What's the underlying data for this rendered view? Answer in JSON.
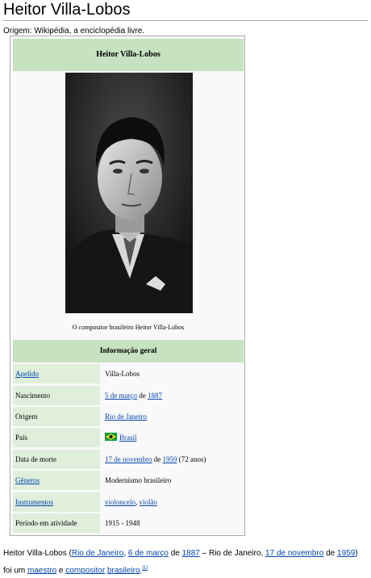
{
  "page": {
    "title": "Heitor Villa-Lobos",
    "subtitle": "Origem: Wikipédia, a enciclopédia livre."
  },
  "infobox": {
    "header": "Heitor Villa-Lobos",
    "caption": "O compositor brasileiro Heitor Villa-Lobos",
    "info_header": "Informação geral",
    "rows": [
      {
        "label": "Apelido",
        "label_link": true,
        "value": "Villa-Lobos"
      },
      {
        "label": "Nascimento",
        "label_link": false,
        "value_link_1": "5 de março",
        "value_text": " de ",
        "value_link_2": "1887"
      },
      {
        "label": "Origem",
        "label_link": false,
        "value": "Rio de Janeiro"
      },
      {
        "label": "País",
        "label_link": false,
        "value": "Brasil"
      },
      {
        "label": "Data de morte",
        "label_link": false,
        "value_link_1": "17 de novembro",
        "value_text_1": " de ",
        "value_link_2": "1959",
        "value_text_2": " (72 anos)"
      },
      {
        "label": "Gêneros",
        "label_link": true,
        "value": "Modernismo brasileiro"
      },
      {
        "label": "Instrumentos",
        "label_link": true,
        "value_link_1": "violoncelo",
        "value_text": ", ",
        "value_link_2": "violão"
      },
      {
        "label": "Período em atividade",
        "label_link": false,
        "value": "1915 - 1948"
      }
    ]
  },
  "intro": {
    "name": "Heitor Villa-Lobos",
    "open": " (",
    "birth_city": "Rio de Janeiro",
    "comma": ", ",
    "birth_day": "6 de março",
    "de1": " de ",
    "birth_year": "1887",
    "dash": " – Rio de Janeiro, ",
    "death_day": "17 de novembro",
    "de2": " de ",
    "death_year": "1959",
    "close": ")",
    "line2_a": "foi um ",
    "maestro": "maestro",
    "e": " e ",
    "compositor": "compositor",
    "space": " ",
    "brasileiro": "brasileiro",
    "dot": ".",
    "ref": "[1]"
  },
  "colors": {
    "header_green": "#c6e2c1",
    "label_green": "#dfefdb",
    "link": "#0645ad"
  },
  "icons": {
    "flag": "brazil-flag-icon"
  }
}
